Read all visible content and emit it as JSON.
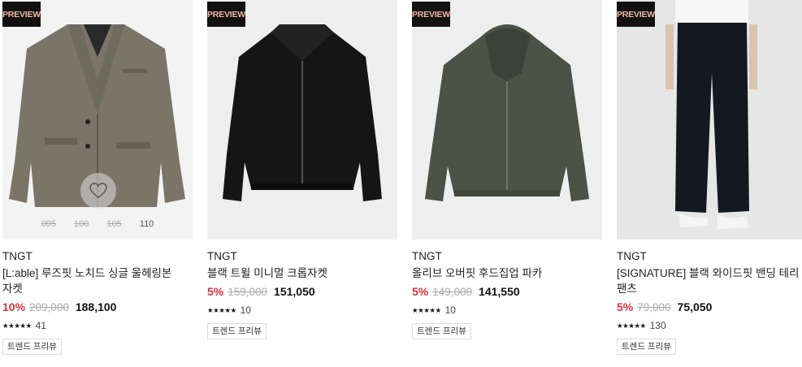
{
  "products": [
    {
      "badge": "PREVIEW",
      "brand": "TNGT",
      "name": "[L:able] 루즈핏 노치드 싱글 울헤링본 자켓",
      "discount": "10%",
      "original_price": "209,000",
      "price": "188,100",
      "stars": "★★★★★",
      "review_count": "41",
      "tag": "트렌드 프리뷰",
      "sizes": [
        {
          "label": "095",
          "sold_out": true
        },
        {
          "label": "100",
          "sold_out": true
        },
        {
          "label": "105",
          "sold_out": true
        },
        {
          "label": "110",
          "sold_out": false
        }
      ],
      "image_icon": "herringbone-blazer-image"
    },
    {
      "badge": "PREVIEW",
      "brand": "TNGT",
      "name": "블랙 트윌 미니멀 크롭자켓",
      "discount": "5%",
      "original_price": "159,000",
      "price": "151,050",
      "stars": "★★★★★",
      "review_count": "10",
      "tag": "트렌드 프리뷰",
      "image_icon": "black-crop-jacket-image"
    },
    {
      "badge": "PREVIEW",
      "brand": "TNGT",
      "name": "올리브 오버핏 후드집업 파카",
      "discount": "5%",
      "original_price": "149,000",
      "price": "141,550",
      "stars": "★★★★★",
      "review_count": "10",
      "tag": "트렌드 프리뷰",
      "image_icon": "olive-hood-parka-image"
    },
    {
      "badge": "PREVIEW",
      "brand": "TNGT",
      "name": "[SIGNATURE] 블랙 와이드핏 밴딩 테리 팬츠",
      "discount": "5%",
      "original_price": "79,000",
      "price": "75,050",
      "stars": "★★★★★",
      "review_count": "130",
      "tag": "트렌드 프리뷰",
      "image_icon": "black-wide-pants-image"
    }
  ],
  "colors": {
    "discount": "#e0303d",
    "badge_bg": "#111111",
    "badge_text": "#f5b6a5"
  },
  "icons": {
    "wishlist": "heart-icon"
  }
}
